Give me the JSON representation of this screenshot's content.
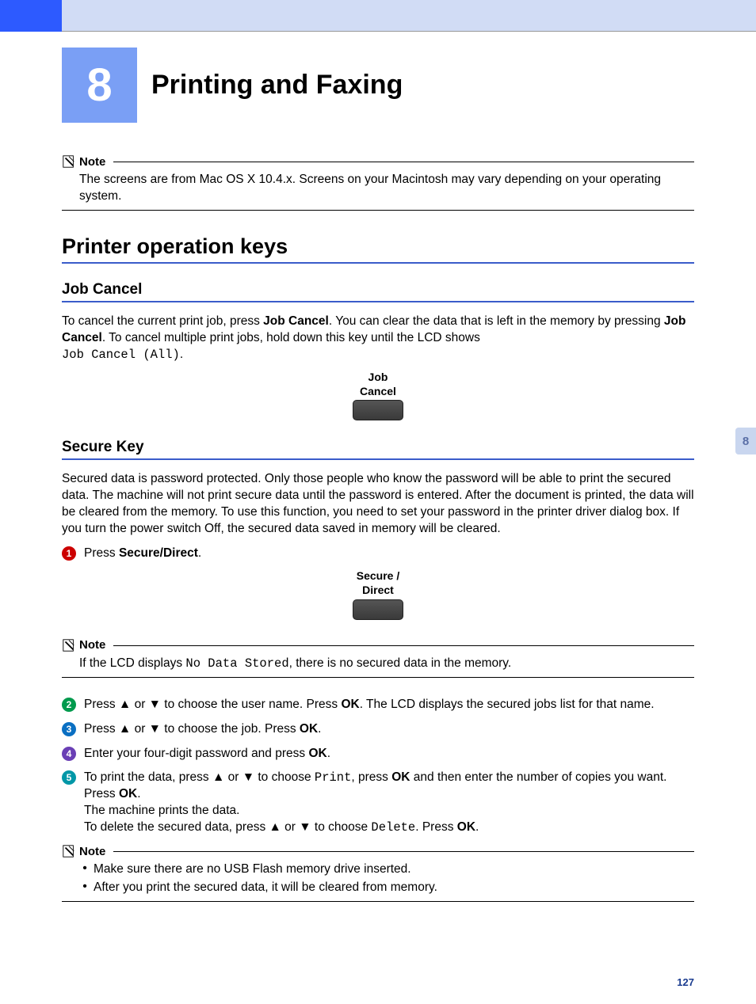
{
  "chapter": {
    "number": "8",
    "title": "Printing and Faxing"
  },
  "note1": {
    "label": "Note",
    "body": "The screens are from Mac OS X 10.4.x. Screens on your Macintosh may vary depending on your operating system."
  },
  "section1": {
    "title": "Printer operation keys"
  },
  "sub1": {
    "title": "Job Cancel",
    "para_pre": "To cancel the current print job, press ",
    "bold1": "Job Cancel",
    "para_mid1": ". You can clear the data that is left in the memory by pressing ",
    "bold2": "Job Cancel",
    "para_mid2": ". To cancel multiple print jobs, hold down this key until the LCD shows ",
    "mono": "Job Cancel (All)",
    "para_end": ".",
    "btn_line1": "Job",
    "btn_line2": "Cancel"
  },
  "sub2": {
    "title": "Secure Key",
    "para": "Secured data is password protected. Only those people who know the password will be able to print the secured data. The machine will not print secure data until the password is entered. After the document is printed, the data will be cleared from the memory. To use this function, you need to set your password in the printer driver dialog box. If you turn the power switch Off, the secured data saved in memory will be cleared.",
    "step1_pre": "Press ",
    "step1_bold": "Secure/Direct",
    "step1_post": ".",
    "btn_line1": "Secure /",
    "btn_line2": "Direct"
  },
  "note2": {
    "label": "Note",
    "pre": "If the LCD displays ",
    "mono": "No Data Stored",
    "post": ", there is no secured data in the memory."
  },
  "steps": {
    "s2_pre": "Press ▲ or ▼ to choose the user name. Press ",
    "s2_bold": "OK",
    "s2_post": ". The LCD displays the secured jobs list for that name.",
    "s3_pre": "Press ▲ or ▼ to choose the job. Press ",
    "s3_bold": "OK",
    "s3_post": ".",
    "s4_pre": "Enter your four-digit password and press ",
    "s4_bold": "OK",
    "s4_post": ".",
    "s5_a_pre": "To print the data, press ▲ or ▼ to choose ",
    "s5_a_mono": "Print",
    "s5_a_mid": ", press ",
    "s5_a_bold": "OK",
    "s5_a_post": " and then enter the number of copies you want. Press ",
    "s5_a_bold2": "OK",
    "s5_a_end": ".",
    "s5_b": "The machine prints the data.",
    "s5_c_pre": "To delete the secured data, press ▲ or ▼ to choose ",
    "s5_c_mono": "Delete",
    "s5_c_mid": ". Press ",
    "s5_c_bold": "OK",
    "s5_c_post": "."
  },
  "note3": {
    "label": "Note",
    "b1": "Make sure there are no USB Flash memory drive inserted.",
    "b2": "After you print the secured data, it will be cleared from memory."
  },
  "tab": "8",
  "pagenum": "127"
}
